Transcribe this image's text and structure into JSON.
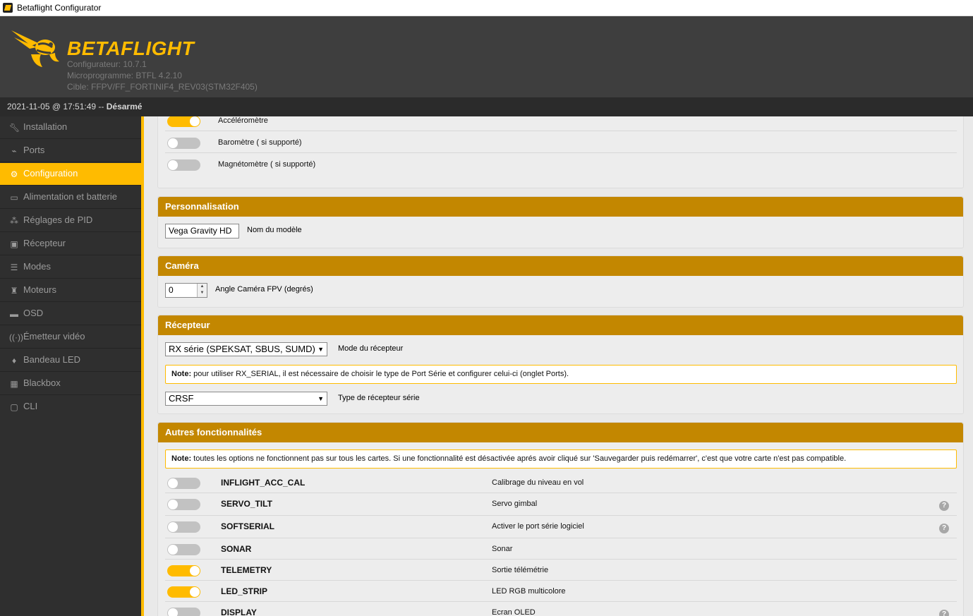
{
  "window": {
    "title": "Betaflight Configurator"
  },
  "header": {
    "brand": "BETAFLIGHT",
    "configurator": "Configurateur: 10.7.1",
    "firmware": "Microprogramme: BTFL 4.2.10",
    "target": "Cible: FFPV/FF_FORTINIF4_REV03(STM32F405)"
  },
  "status": {
    "datetime": "2021-11-05 @ 17:51:49 --",
    "state": "Désarmé"
  },
  "sidebar": {
    "items": [
      {
        "label": "Installation",
        "icon": "wrench-icon",
        "active": false
      },
      {
        "label": "Ports",
        "icon": "plug-icon",
        "active": false
      },
      {
        "label": "Configuration",
        "icon": "gear-icon",
        "active": true
      },
      {
        "label": "Alimentation et batterie",
        "icon": "battery-icon",
        "active": false
      },
      {
        "label": "Réglages de PID",
        "icon": "pid-tree-icon",
        "active": false
      },
      {
        "label": "Récepteur",
        "icon": "receiver-icon",
        "active": false
      },
      {
        "label": "Modes",
        "icon": "modes-icon",
        "active": false
      },
      {
        "label": "Moteurs",
        "icon": "motor-icon",
        "active": false
      },
      {
        "label": "OSD",
        "icon": "osd-icon",
        "active": false
      },
      {
        "label": "Émetteur vidéo",
        "icon": "antenna-icon",
        "active": false
      },
      {
        "label": "Bandeau LED",
        "icon": "led-icon",
        "active": false
      },
      {
        "label": "Blackbox",
        "icon": "chip-icon",
        "active": false
      },
      {
        "label": "CLI",
        "icon": "terminal-icon",
        "active": false
      }
    ]
  },
  "sensors": [
    {
      "label": "Accéléromètre",
      "on": true
    },
    {
      "label": "Baromètre ( si supporté)",
      "on": false
    },
    {
      "label": "Magnétomètre ( si supporté)",
      "on": false
    }
  ],
  "personalization": {
    "title": "Personnalisation",
    "model_name": "Vega Gravity HD",
    "model_label": "Nom du modèle"
  },
  "camera": {
    "title": "Caméra",
    "angle": "0",
    "angle_label": "Angle Caméra FPV (degrés)"
  },
  "receiver": {
    "title": "Récepteur",
    "mode": "RX série (SPEKSAT, SBUS, SUMD)",
    "mode_label": "Mode du récepteur",
    "note_prefix": "Note:",
    "note_text": " pour utiliser RX_SERIAL, il est nécessaire de choisir le type de Port Série et configurer celui-ci (onglet Ports).",
    "serial_type": "CRSF",
    "serial_label": "Type de récepteur série"
  },
  "features": {
    "title": "Autres fonctionnalités",
    "note_prefix": "Note:",
    "note_text": " toutes les options ne fonctionnent pas sur tous les cartes. Si une fonctionnalité est désactivée aprés avoir cliqué sur 'Sauvegarder puis redémarrer', c'est que votre carte n'est pas compatible.",
    "items": [
      {
        "name": "INFLIGHT_ACC_CAL",
        "desc": "Calibrage du niveau en vol",
        "on": false,
        "help": false
      },
      {
        "name": "SERVO_TILT",
        "desc": "Servo gimbal",
        "on": false,
        "help": true
      },
      {
        "name": "SOFTSERIAL",
        "desc": "Activer le port série logiciel",
        "on": false,
        "help": true
      },
      {
        "name": "SONAR",
        "desc": "Sonar",
        "on": false,
        "help": false
      },
      {
        "name": "TELEMETRY",
        "desc": "Sortie télémétrie",
        "on": true,
        "help": false
      },
      {
        "name": "LED_STRIP",
        "desc": "LED RGB multicolore",
        "on": true,
        "help": false
      },
      {
        "name": "DISPLAY",
        "desc": "Ecran OLED",
        "on": false,
        "help": true
      }
    ]
  },
  "colors": {
    "accent": "#ffbb00",
    "section_header": "#c38700",
    "sidebar": "#2f2f2f"
  }
}
